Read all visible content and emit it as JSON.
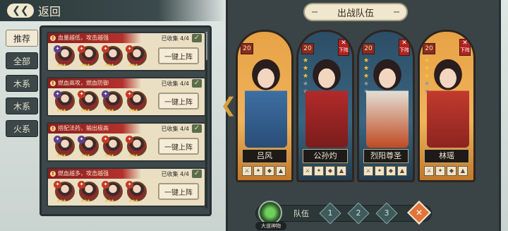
{
  "nav": {
    "back_label": "返回",
    "back_icon": "back-arrow-icon"
  },
  "filters": [
    {
      "label": "推荐",
      "active": true
    },
    {
      "label": "全部",
      "active": false
    },
    {
      "label": "木系",
      "active": false
    },
    {
      "label": "木系",
      "active": false
    },
    {
      "label": "火系",
      "active": false
    }
  ],
  "combos": [
    {
      "desc": "血量越低，攻击越强",
      "collected": "已收集 4/4",
      "button": "一键上阵"
    },
    {
      "desc": "燃血高攻，燃血防御",
      "collected": "已收集 4/4",
      "button": "一键上阵"
    },
    {
      "desc": "搭配法药，输出极高",
      "collected": "已收集 4/4",
      "button": "一键上阵"
    },
    {
      "desc": "燃血越多，攻击越强",
      "collected": "已收集 4/4",
      "button": "一键上阵"
    }
  ],
  "lineup": {
    "title": "出战队伍",
    "remove_label": "下阵",
    "heroes": [
      {
        "name": "吕风",
        "level": "20",
        "stars": 0,
        "frame": "gold",
        "robe": "#3d6fa3",
        "robe2": "#2a4d76",
        "removable": false,
        "equips": [
          "⚔",
          "✦",
          "◆",
          "▲"
        ]
      },
      {
        "name": "公孙灼",
        "level": "20",
        "stars": 3,
        "frame": "blue",
        "robe": "#b32a2a",
        "robe2": "#7a1c1c",
        "removable": true,
        "equips": [
          "⚔",
          "✦",
          "◆",
          "▲"
        ]
      },
      {
        "name": "烈阳尊圣",
        "level": "20",
        "stars": 3,
        "frame": "blue",
        "robe": "#e3e0d6",
        "robe2": "#c04a22",
        "removable": true,
        "equips": [
          "⚔",
          "✦",
          "◆",
          "▲"
        ]
      },
      {
        "name": "林瑶",
        "level": "20",
        "stars": 3,
        "frame": "gold",
        "robe": "#c23a2e",
        "robe2": "#8c2420",
        "removable": true,
        "equips": [
          "⚔",
          "✦",
          "◆",
          "▲"
        ]
      }
    ]
  },
  "team": {
    "label": "队伍",
    "slots": [
      "1",
      "2",
      "3"
    ],
    "sacred_label": "大道神物"
  }
}
